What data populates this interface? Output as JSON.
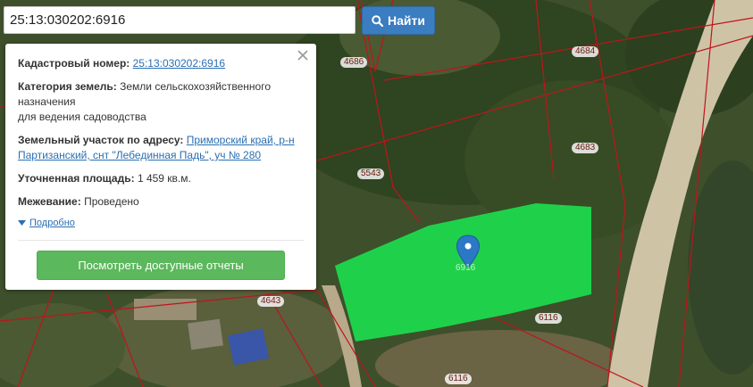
{
  "search": {
    "value": "25:13:030202:6916",
    "button_label": "Найти",
    "button_icon": "search-icon"
  },
  "popup": {
    "cadastral_label": "Кадастровый номер:",
    "cadastral_value": "25:13:030202:6916",
    "category_label": "Категория земель:",
    "category_value_line1": "Земли сельскохозяйственного",
    "category_value_line2": "назначения",
    "category_value_line3": "для ведения садоводства",
    "address_label": "Земельный участок по адресу:",
    "address_value_line1": "Приморский край, р-н",
    "address_value_line2": "Партизанский, снт \"Лебединная Падь\", уч № 280",
    "area_label": "Уточненная площадь:",
    "area_value": "1 459 кв.м.",
    "survey_label": "Межевание:",
    "survey_value": "Проведено",
    "details_link": "Подробно",
    "reports_button": "Посмотреть доступные отчеты",
    "close_icon": "close-icon"
  },
  "map": {
    "parcel_labels": [
      "4686",
      "4684",
      "4683",
      "5543",
      "4643",
      "6116",
      "6116",
      "6916"
    ],
    "highlight_color": "#1fd14a",
    "boundary_color": "#c0141b",
    "marker_color": "#2b78c6"
  }
}
